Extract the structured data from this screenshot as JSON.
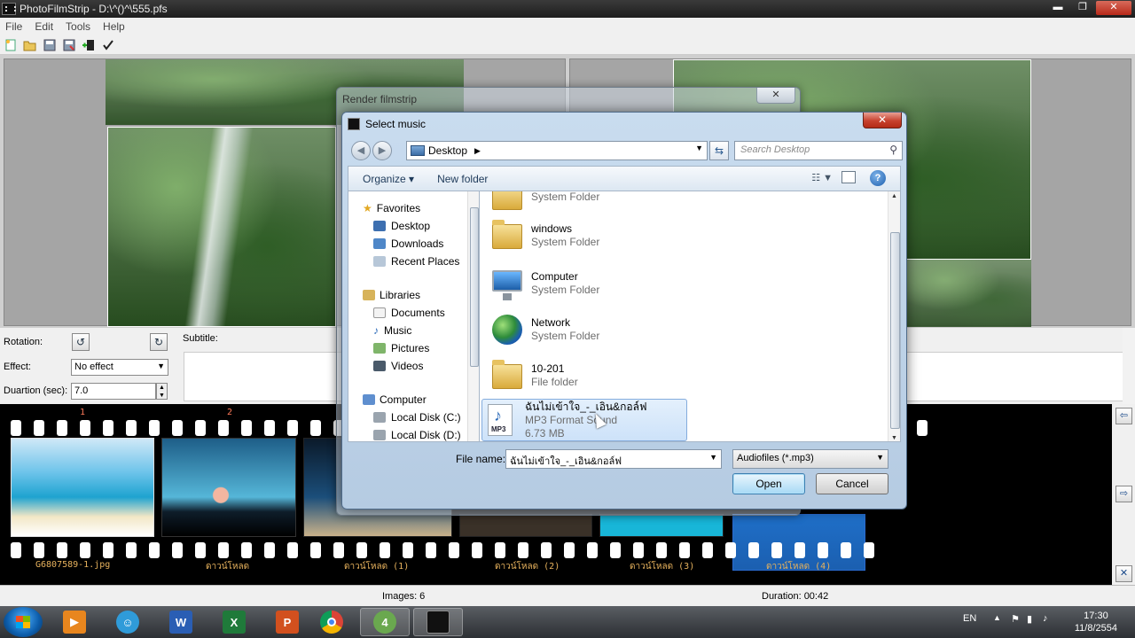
{
  "app": {
    "title": "PhotoFilmStrip - D:\\^()^\\555.pfs",
    "menu": [
      "File",
      "Edit",
      "Tools",
      "Help"
    ],
    "window_controls": {
      "minimize": "▬",
      "restore": "❐",
      "close": "✕"
    }
  },
  "props": {
    "rotation_label": "Rotation:",
    "effect_label": "Effect:",
    "effect_value": "No effect",
    "duration_label": "Duartion (sec):",
    "duration_value": "7.0",
    "subtitle_label": "Subtitle:"
  },
  "filmstrip": {
    "frame_numbers": [
      "1",
      "2"
    ],
    "captions": [
      "G6807589-1.jpg",
      "ดาวน์โหลด",
      "ดาวน์โหลด (1)",
      "ดาวน์โหลด (2)",
      "ดาวน์โหลด (3)",
      "ดาวน์โหลด (4)"
    ]
  },
  "status": {
    "images": "Images: 6",
    "duration": "Duration: 00:42"
  },
  "render_dialog": {
    "title": "Render filmstrip",
    "close": "✕"
  },
  "music_dialog": {
    "title": "Select music",
    "close": "✕",
    "address": "Desktop",
    "search_placeholder": "Search Desktop",
    "organize": "Organize ▾",
    "new_folder": "New folder",
    "nav": {
      "favorites": "Favorites",
      "desktop": "Desktop",
      "downloads": "Downloads",
      "recent": "Recent Places",
      "libraries": "Libraries",
      "documents": "Documents",
      "music": "Music",
      "pictures": "Pictures",
      "videos": "Videos",
      "computer": "Computer",
      "local_c": "Local Disk (C:)",
      "local_d": "Local Disk (D:)"
    },
    "files": [
      {
        "name": "",
        "sub": "System Folder"
      },
      {
        "name": "windows",
        "sub": "System Folder"
      },
      {
        "name": "Computer",
        "sub": "System Folder"
      },
      {
        "name": "Network",
        "sub": "System Folder"
      },
      {
        "name": "10-201",
        "sub": "File folder"
      },
      {
        "name": "ฉันไม่เข้าใจ_-_เอิน&กอล์ฟ",
        "sub": "MP3 Format Sound",
        "size": "6.73 MB"
      }
    ],
    "file_name_label": "File name:",
    "file_name_value": "ฉันไม่เข้าใจ_-_เอิน&กอล์ฟ",
    "file_type": "Audiofiles (*.mp3)",
    "open": "Open",
    "cancel": "Cancel"
  },
  "taskbar": {
    "lang": "EN",
    "time": "17:30",
    "date": "11/8/2554"
  }
}
